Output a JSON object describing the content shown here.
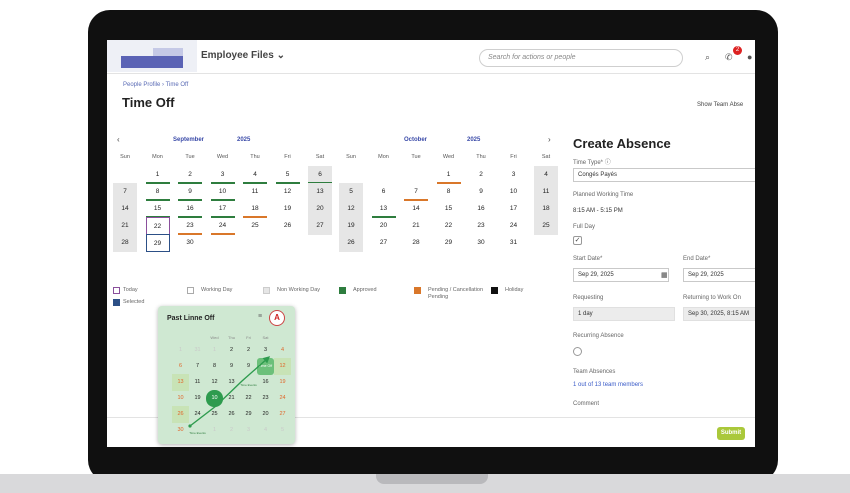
{
  "app": {
    "name": "Employee Files",
    "search_placeholder": "Search for actions or people",
    "notification_count": "2"
  },
  "breadcrumb": "People Profile › Time Off",
  "page_title": "Time Off",
  "show_team_label": "Show Team Abse",
  "calendar": {
    "months": [
      {
        "name": "September",
        "year": "2025"
      },
      {
        "name": "October",
        "year": "2025"
      }
    ],
    "prev_icon": "‹",
    "next_icon": "›",
    "weekdays": [
      "Sun",
      "Mon",
      "Tue",
      "Wed",
      "Thu",
      "Fri",
      "Sat"
    ],
    "september_weeks": [
      [
        "",
        "1",
        "2",
        "3",
        "4",
        "5",
        "6"
      ],
      [
        "7",
        "8",
        "9",
        "10",
        "11",
        "12",
        "13"
      ],
      [
        "14",
        "15",
        "16",
        "17",
        "18",
        "19",
        "20"
      ],
      [
        "21",
        "22",
        "23",
        "24",
        "25",
        "26",
        "27"
      ],
      [
        "28",
        "29",
        "30",
        "",
        "",
        "",
        ""
      ]
    ],
    "october_weeks": [
      [
        "",
        "",
        "",
        "1",
        "2",
        "3",
        "4"
      ],
      [
        "5",
        "6",
        "7",
        "8",
        "9",
        "10",
        "11"
      ],
      [
        "12",
        "13",
        "14",
        "15",
        "16",
        "17",
        "18"
      ],
      [
        "19",
        "20",
        "21",
        "22",
        "23",
        "24",
        "25"
      ],
      [
        "26",
        "27",
        "28",
        "29",
        "30",
        "31",
        ""
      ]
    ]
  },
  "legend": [
    {
      "label": "Today",
      "color": "#8a4f9c"
    },
    {
      "label": "Selected",
      "color": "#2c4f86"
    },
    {
      "label": "Working Day",
      "color": "#ffffff"
    },
    {
      "label": "Non Working Day",
      "color": "#e6e6e6"
    },
    {
      "label": "Approved",
      "color": "#2e7d3e"
    },
    {
      "label": "Pending / Cancellation Pending",
      "color": "#d9772a"
    },
    {
      "label": "Holiday",
      "color": "#111111"
    }
  ],
  "create_absence": {
    "title": "Create Absence",
    "time_type_label": "Time Type*",
    "time_type_value": "Congés Payés",
    "planned_label": "Planned Working Time",
    "planned_value": "8:15 AM - 5:15 PM",
    "full_day_label": "Full Day",
    "full_day_checked": true,
    "start_label": "Start Date*",
    "start_value": "Sep 29, 2025",
    "end_label": "End Date*",
    "end_value": "Sep 29, 2025",
    "requesting_label": "Requesting",
    "requesting_value": "1 day",
    "returning_label": "Returning to Work On",
    "returning_value": "Sep 30, 2025, 8:15 AM",
    "recurring_label": "Recurring Absence",
    "team_absences_label": "Team Absences",
    "team_absences_link": "1 out of 13 team members",
    "comment_label": "Comment",
    "submit_label": "Submit"
  },
  "popup": {
    "title": "Past Linne Off",
    "pin_icon": "≡",
    "avatar_letter": "A",
    "weekdays": [
      "",
      "",
      "Wed",
      "Thu",
      "Fri",
      "Sat",
      ""
    ],
    "rows": [
      [
        "1",
        "31",
        "1",
        "2",
        "2",
        "3",
        "4"
      ],
      [
        "6",
        "7",
        "8",
        "9",
        "9",
        "Time Off",
        "12"
      ],
      [
        "13",
        "11",
        "12",
        "13",
        "Time Events",
        "16",
        "19"
      ],
      [
        "10",
        "19",
        "10",
        "21",
        "22",
        "23",
        "24"
      ],
      [
        "26",
        "24",
        "25",
        "26",
        "29",
        "20",
        "27"
      ],
      [
        "30",
        "Time Events",
        "1",
        "2",
        "3",
        "4",
        "5"
      ]
    ]
  },
  "colors": {
    "brand": "#5b63b5",
    "approved": "#2e7d3e",
    "pending": "#d9772a",
    "submit": "#aac83a",
    "today": "#8a4f9c",
    "selected": "#2c4f86"
  }
}
